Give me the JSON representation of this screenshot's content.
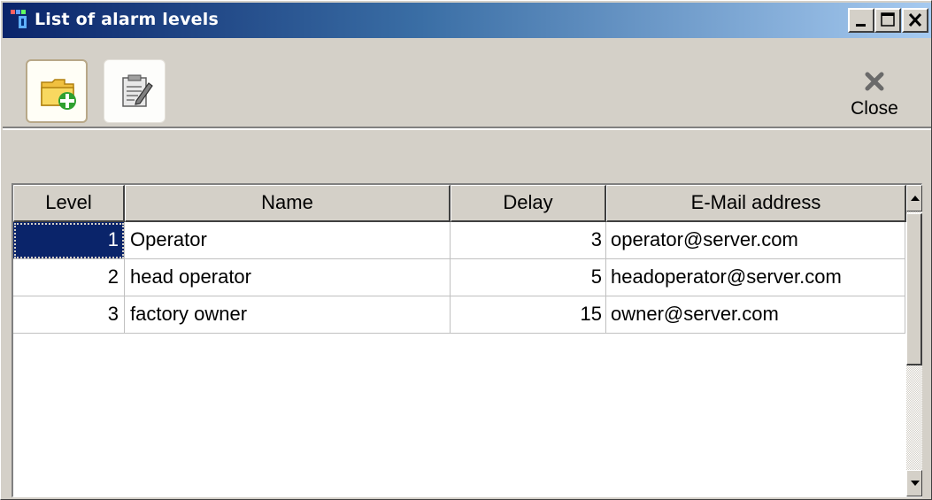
{
  "window": {
    "title": "List of alarm levels",
    "controls": {
      "minimize": "minimize-icon",
      "maximize": "maximize-icon",
      "close": "close-icon"
    }
  },
  "toolbar": {
    "add_icon": "folder-add-icon",
    "edit_icon": "clipboard-edit-icon",
    "close_label": "Close",
    "close_icon": "x-icon"
  },
  "table": {
    "columns": [
      "Level",
      "Name",
      "Delay",
      "E-Mail address"
    ],
    "rows": [
      {
        "level": "1",
        "name": "Operator",
        "delay": "3",
        "email": "operator@server.com"
      },
      {
        "level": "2",
        "name": "head operator",
        "delay": "5",
        "email": "headoperator@server.com"
      },
      {
        "level": "3",
        "name": "factory owner",
        "delay": "15",
        "email": "owner@server.com"
      }
    ],
    "selected_row": 0
  },
  "colors": {
    "titlebar_start": "#0a246a",
    "titlebar_end": "#a6caf0",
    "face": "#d4d0c8",
    "selection": "#0a246a"
  }
}
